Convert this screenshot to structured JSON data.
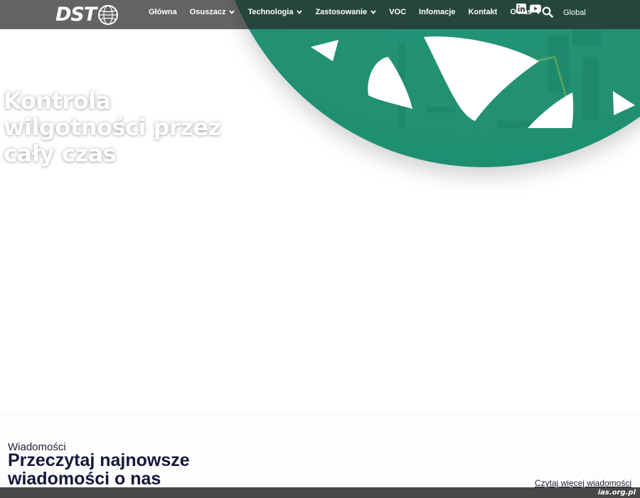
{
  "brand": {
    "logo_text": "DST",
    "globe_icon": "globe-icon"
  },
  "nav": {
    "items": [
      {
        "label": "Główna",
        "dropdown": false
      },
      {
        "label": "Osuszacz",
        "dropdown": true
      },
      {
        "label": "Technologia",
        "dropdown": true
      },
      {
        "label": "Zastosowanie",
        "dropdown": true
      },
      {
        "label": "VOC",
        "dropdown": false
      },
      {
        "label": "Infomacje",
        "dropdown": false
      },
      {
        "label": "Kontakt",
        "dropdown": false
      },
      {
        "label": "O nas",
        "dropdown": true
      }
    ],
    "social": [
      "linkedin-icon",
      "youtube-icon"
    ],
    "search_icon": "search-icon",
    "region_label": "Global"
  },
  "hero": {
    "heading_lines": [
      "Kontrola",
      "wilgotności przez",
      "cały czas"
    ]
  },
  "news": {
    "eyebrow": "Wiadomości",
    "title_lines": [
      "Przeczytaj najnowsze",
      "wiadomości o nas"
    ],
    "more_link": "Czytaj więcej wiadomości"
  },
  "footer": {
    "watermark": "ias.org.pl"
  },
  "colors": {
    "nav_background": "#282828",
    "hero_green": "#2a9f7e",
    "news_title": "#14193a",
    "bottom_bar": "#474747"
  }
}
